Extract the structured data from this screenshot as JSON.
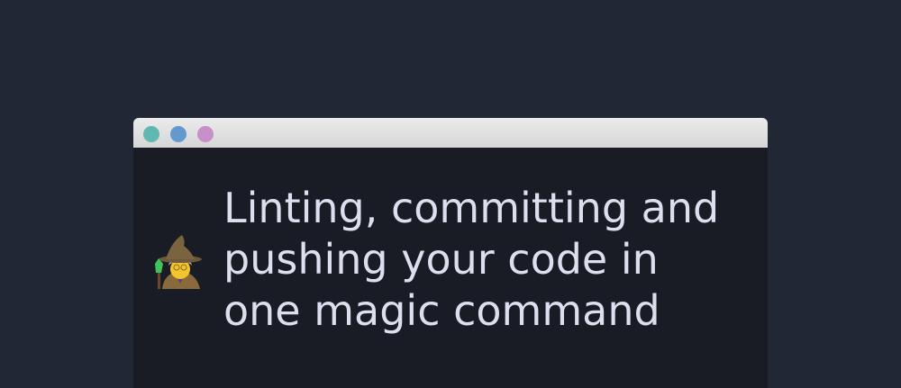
{
  "window": {
    "buttons": [
      {
        "name": "close",
        "color": "#5fb9b2"
      },
      {
        "name": "minimize",
        "color": "#6399cf"
      },
      {
        "name": "maximize",
        "color": "#c98fca"
      }
    ]
  },
  "content": {
    "emoji": "🧙‍♀️",
    "title_lines": [
      "Linting, committing and",
      "pushing your code in",
      "one magic command"
    ]
  }
}
